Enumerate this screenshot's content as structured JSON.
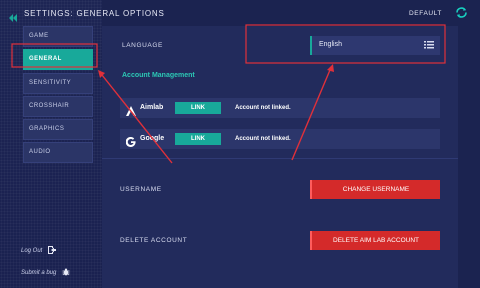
{
  "header": {
    "title": "SETTINGS: GENERAL OPTIONS",
    "default_label": "DEFAULT"
  },
  "nav": {
    "items": [
      {
        "label": "GAME"
      },
      {
        "label": "GENERAL"
      },
      {
        "label": "SENSITIVITY"
      },
      {
        "label": "CROSSHAIR"
      },
      {
        "label": "GRAPHICS"
      },
      {
        "label": "AUDIO"
      }
    ],
    "active_index": 1
  },
  "side_links": {
    "logout": "Log Out",
    "bug": "Submit a bug"
  },
  "language": {
    "label": "LANGUAGE",
    "value": "English"
  },
  "account_management": {
    "title": "Account Management",
    "accounts": [
      {
        "name": "Aimlab",
        "button": "LINK",
        "status": "Account not linked."
      },
      {
        "name": "Google",
        "button": "LINK",
        "status": "Account not linked."
      }
    ]
  },
  "username": {
    "label": "USERNAME",
    "button": "CHANGE USERNAME"
  },
  "delete_account": {
    "label": "DELETE ACCOUNT",
    "button": "DELETE AIM LAB ACCOUNT"
  },
  "colors": {
    "accent": "#18a99a",
    "danger": "#d42a2a",
    "annotation": "#e0303a"
  }
}
